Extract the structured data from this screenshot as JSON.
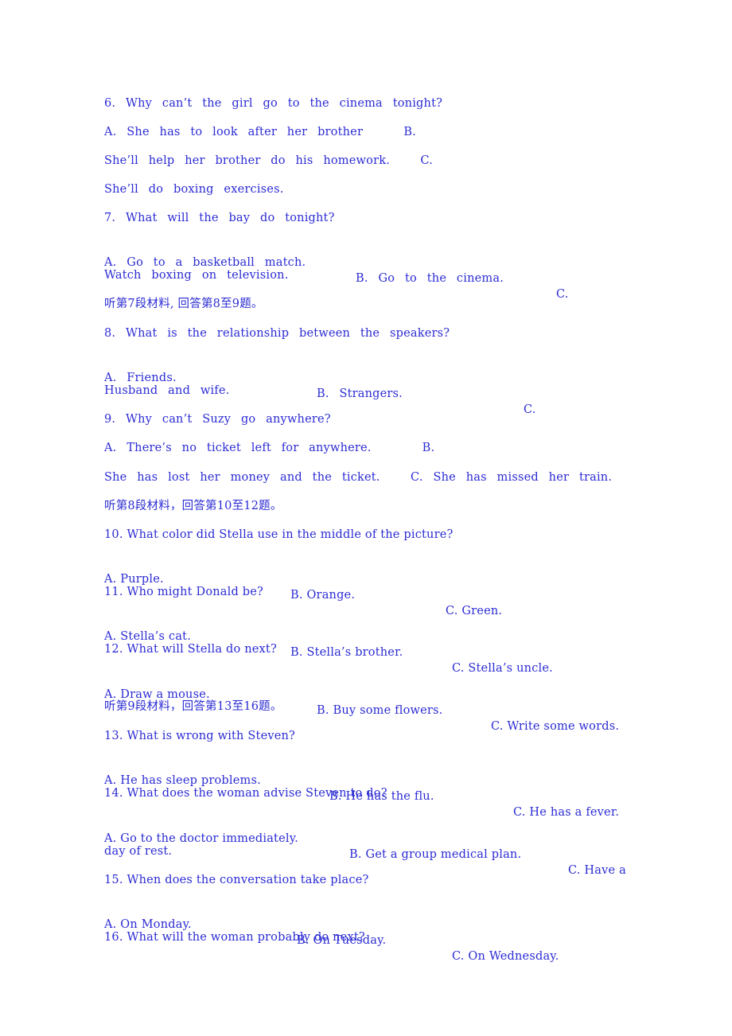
{
  "colors": {
    "text": "#2b2bd4",
    "background": "#ffffff"
  },
  "lines": [
    {
      "type": "question",
      "text": "6. Why can’t the girl go to the cinema tonight?"
    },
    {
      "type": "options",
      "text": "A. She has to look after her brother    B."
    },
    {
      "type": "options",
      "text": "She’ll help her brother do his homework.   C."
    },
    {
      "type": "options",
      "text": "She’ll do boxing exercises."
    },
    {
      "type": "question",
      "text": "7. What will the bay do tonight?"
    },
    {
      "type": "options",
      "segments": [
        "A. Go to a basketball match.",
        "B. Go to the cinema.",
        "C."
      ]
    },
    {
      "type": "options",
      "text": "Watch boxing on television."
    },
    {
      "type": "section",
      "text": "听第7段材料, 回答第8至9题。"
    },
    {
      "type": "question",
      "text": "8. What is the relationship between the speakers?"
    },
    {
      "type": "options",
      "segments": [
        "A. Friends.",
        "B. Strangers.",
        "C."
      ]
    },
    {
      "type": "options",
      "text": "Husband and wife."
    },
    {
      "type": "question",
      "text": "9. Why can’t Suzy go anywhere?"
    },
    {
      "type": "options",
      "text": "A. There’s no ticket left for anywhere.     B."
    },
    {
      "type": "options",
      "text": "She has lost her money and the ticket.   C. She has missed her train."
    },
    {
      "type": "section",
      "text": "听第8段材料，回答第10至12题。"
    },
    {
      "type": "question",
      "text": "10. What color did Stella use in the middle of the picture?"
    },
    {
      "type": "options",
      "segments": [
        "A. Purple.",
        "B. Orange.",
        "C. Green."
      ]
    },
    {
      "type": "question",
      "text": "11. Who might Donald be?"
    },
    {
      "type": "options",
      "segments": [
        "A. Stella’s cat.",
        "B. Stella’s brother.",
        "C. Stella’s uncle."
      ]
    },
    {
      "type": "question",
      "text": "12. What will Stella do next?"
    },
    {
      "type": "options",
      "segments": [
        "A. Draw a mouse.",
        "B. Buy some flowers.",
        "C. Write some words."
      ]
    },
    {
      "type": "section",
      "text": "听第9段材料，回答第13至16题。"
    },
    {
      "type": "question",
      "text": "13. What is wrong with Steven?"
    },
    {
      "type": "options",
      "segments": [
        "A. He has sleep problems.",
        "B. He has the flu.",
        "C. He has a fever."
      ]
    },
    {
      "type": "question",
      "text": "14. What does the woman advise Steven to do?"
    },
    {
      "type": "options",
      "segments": [
        "A. Go to the doctor immediately.",
        "B. Get a group medical plan.",
        "C. Have a"
      ]
    },
    {
      "type": "options",
      "text": "day of rest."
    },
    {
      "type": "question",
      "text": "15. When does the conversation take place?"
    },
    {
      "type": "options",
      "segments": [
        "A. On Monday.",
        "B. On Tuesday.",
        "C. On Wednesday."
      ]
    },
    {
      "type": "question",
      "text": "16. What will the woman probably do next?"
    }
  ]
}
